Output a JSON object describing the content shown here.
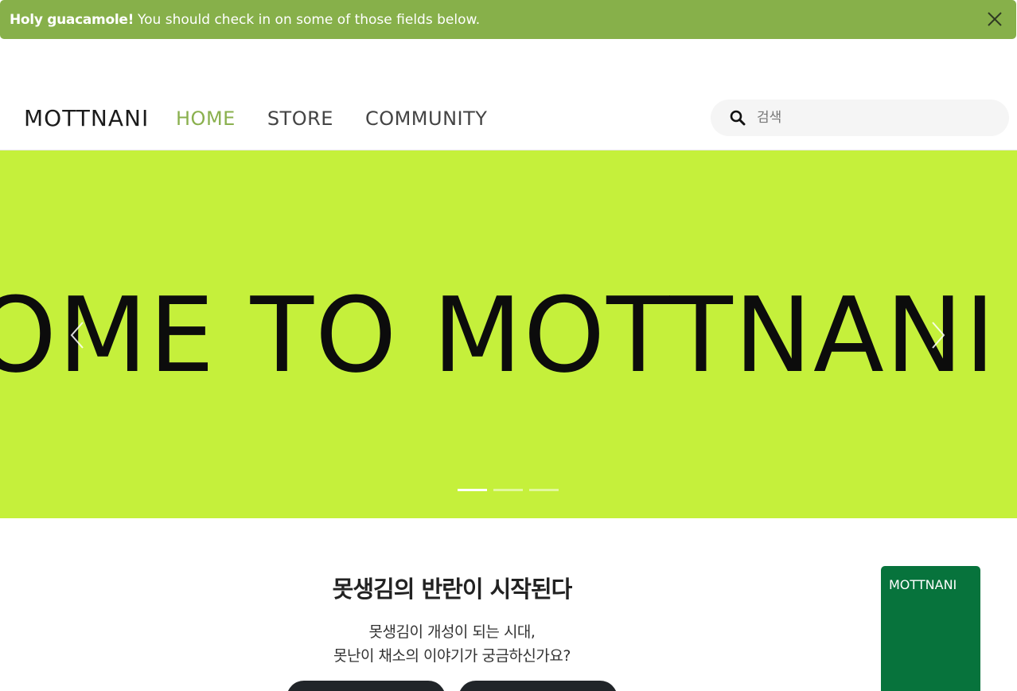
{
  "alert": {
    "strong": "Holy guacamole!",
    "message": "You should check in on some of those fields below.",
    "close_icon": "close-icon"
  },
  "nav": {
    "brand": "MOTTNANI",
    "items": [
      {
        "label": "HOME",
        "active": true
      },
      {
        "label": "STORE",
        "active": false
      },
      {
        "label": "COMMUNITY",
        "active": false
      }
    ],
    "search": {
      "placeholder": "검색",
      "icon": "search-icon"
    }
  },
  "hero": {
    "text": "WELCOME TO MOTTNANI COME",
    "bg_color": "#c5f03b",
    "slide_count": 3,
    "active_slide": 1
  },
  "intro": {
    "title": "못생김의 반란이 시작된다",
    "line1": "못생김이 개성이 되는 시대,",
    "line2": "못난이 채소의 이야기가 궁금하신가요?"
  },
  "side_card": {
    "label": "MOTTNANI",
    "color": "#07733c"
  },
  "colors": {
    "accent": "#8ab04e",
    "alert": "#87b04a"
  }
}
